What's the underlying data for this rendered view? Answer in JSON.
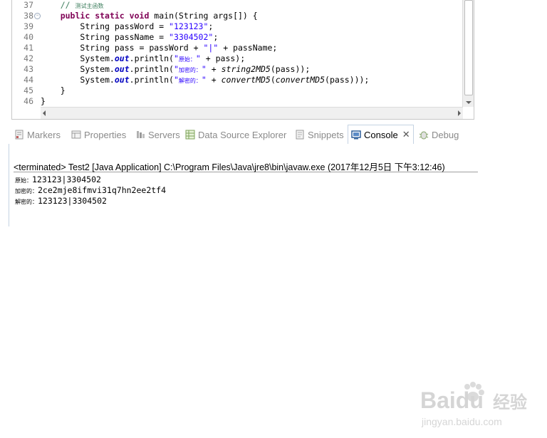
{
  "editor": {
    "lines": [
      {
        "num": "37",
        "indent": "    ",
        "tokens": [
          {
            "t": "// ",
            "c": "cmt"
          },
          {
            "t": "测试主函数",
            "c": "cmt cn"
          }
        ]
      },
      {
        "num": "38",
        "fold": true,
        "indent": "    ",
        "tokens": [
          {
            "t": "public",
            "c": "kw"
          },
          {
            "t": " ",
            "c": ""
          },
          {
            "t": "static",
            "c": "kw"
          },
          {
            "t": " ",
            "c": ""
          },
          {
            "t": "void",
            "c": "kw"
          },
          {
            "t": " main(String args[]) {",
            "c": ""
          }
        ]
      },
      {
        "num": "39",
        "indent": "        ",
        "tokens": [
          {
            "t": "String passWord = ",
            "c": ""
          },
          {
            "t": "\"123123\"",
            "c": "str"
          },
          {
            "t": ";",
            "c": ""
          }
        ]
      },
      {
        "num": "40",
        "indent": "        ",
        "tokens": [
          {
            "t": "String passName = ",
            "c": ""
          },
          {
            "t": "\"3304502\"",
            "c": "str"
          },
          {
            "t": ";",
            "c": ""
          }
        ]
      },
      {
        "num": "41",
        "indent": "        ",
        "tokens": [
          {
            "t": "String pass = passWord + ",
            "c": ""
          },
          {
            "t": "\"|\"",
            "c": "str"
          },
          {
            "t": " + passName;",
            "c": ""
          }
        ]
      },
      {
        "num": "42",
        "indent": "        ",
        "tokens": [
          {
            "t": "System.",
            "c": ""
          },
          {
            "t": "out",
            "c": "fld"
          },
          {
            "t": ".println(",
            "c": ""
          },
          {
            "t": "\"",
            "c": "str"
          },
          {
            "t": "原始：",
            "c": "str cn"
          },
          {
            "t": "\"",
            "c": "str"
          },
          {
            "t": " + pass);",
            "c": ""
          }
        ]
      },
      {
        "num": "43",
        "indent": "        ",
        "tokens": [
          {
            "t": "System.",
            "c": ""
          },
          {
            "t": "out",
            "c": "fld"
          },
          {
            "t": ".println(",
            "c": ""
          },
          {
            "t": "\"",
            "c": "str"
          },
          {
            "t": "加密的：",
            "c": "str cn"
          },
          {
            "t": "\"",
            "c": "str"
          },
          {
            "t": " + ",
            "c": ""
          },
          {
            "t": "string2MD5",
            "c": "meth"
          },
          {
            "t": "(pass));",
            "c": ""
          }
        ]
      },
      {
        "num": "44",
        "indent": "        ",
        "tokens": [
          {
            "t": "System.",
            "c": ""
          },
          {
            "t": "out",
            "c": "fld"
          },
          {
            "t": ".println(",
            "c": ""
          },
          {
            "t": "\"",
            "c": "str"
          },
          {
            "t": "解密的：",
            "c": "str cn"
          },
          {
            "t": "\"",
            "c": "str"
          },
          {
            "t": " + ",
            "c": ""
          },
          {
            "t": "convertMD5",
            "c": "meth"
          },
          {
            "t": "(",
            "c": ""
          },
          {
            "t": "convertMD5",
            "c": "meth"
          },
          {
            "t": "(pass)));",
            "c": ""
          }
        ]
      },
      {
        "num": "45",
        "indent": "    ",
        "tokens": [
          {
            "t": "}",
            "c": ""
          }
        ]
      },
      {
        "num": "46",
        "indent": "",
        "tokens": [
          {
            "t": "}",
            "c": ""
          }
        ]
      }
    ]
  },
  "tabs": [
    {
      "label": "Markers",
      "icon": "markers-icon",
      "active": false
    },
    {
      "label": "Properties",
      "icon": "properties-icon",
      "active": false
    },
    {
      "label": "Servers",
      "icon": "servers-icon",
      "active": false
    },
    {
      "label": "Data Source Explorer",
      "icon": "data-source-explorer-icon",
      "active": false
    },
    {
      "label": "Snippets",
      "icon": "snippets-icon",
      "active": false
    },
    {
      "label": "Console",
      "icon": "console-icon",
      "active": true,
      "close": "✕"
    },
    {
      "label": "Debug",
      "icon": "debug-icon",
      "active": false
    }
  ],
  "console": {
    "header": "<terminated> Test2 [Java Application] C:\\Program Files\\Java\\jre8\\bin\\javaw.exe (2017年12月5日 下午3:12:46)",
    "output": [
      {
        "label": "原始：",
        "value": "123123|3304502"
      },
      {
        "label": "加密的：",
        "value": "2ce2mje8ifmvi31q7hn2ee2tf4"
      },
      {
        "label": "解密的：",
        "value": "123123|3304502"
      }
    ]
  },
  "watermark": {
    "brand": "Baidu",
    "cn": "经验",
    "url": "jingyan.baidu.com"
  },
  "colors": {
    "keyword": "#7f0055",
    "string": "#2a00ff",
    "comment": "#3f7f5f",
    "field": "#0000c0",
    "tab_active_border": "#c5d3e3"
  }
}
